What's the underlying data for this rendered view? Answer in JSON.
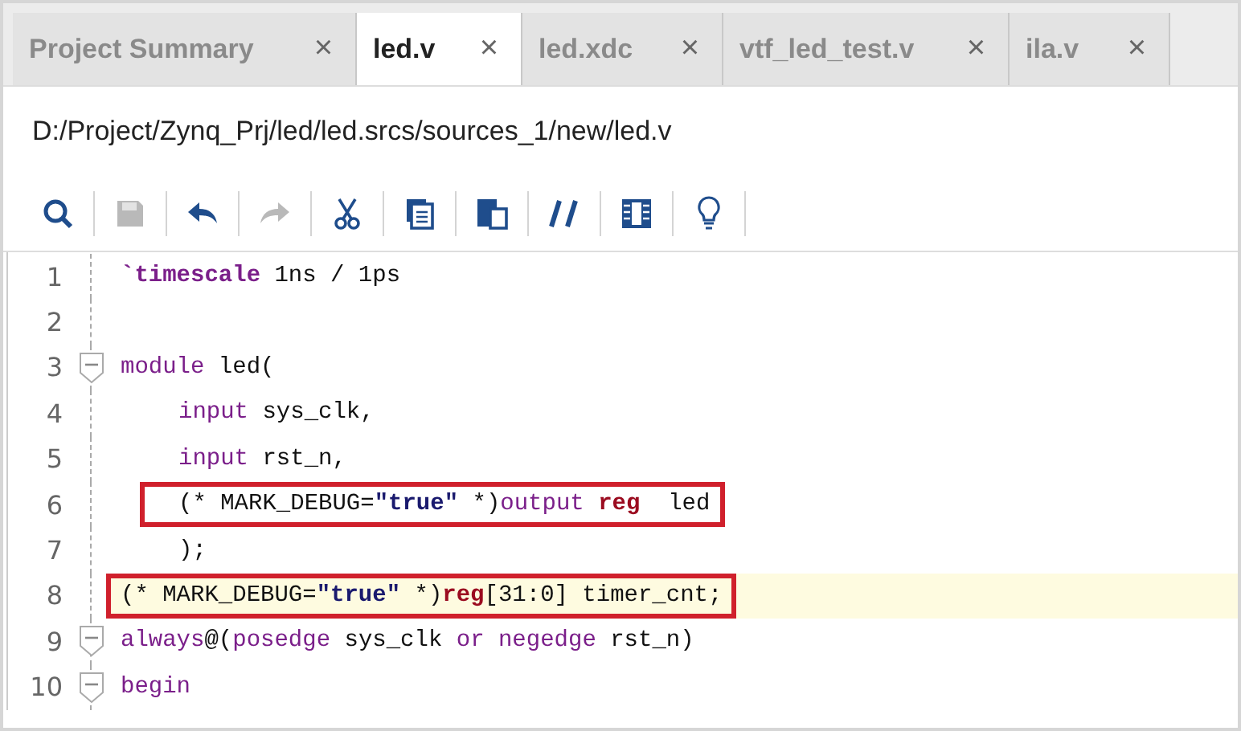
{
  "tabs": [
    {
      "label": "Project Summary",
      "selected": false,
      "close": "×"
    },
    {
      "label": "led.v",
      "selected": true,
      "close": "×"
    },
    {
      "label": "led.xdc",
      "selected": false,
      "close": "×"
    },
    {
      "label": "vtf_led_test.v",
      "selected": false,
      "close": "×"
    },
    {
      "label": "ila.v",
      "selected": false,
      "close": "×"
    }
  ],
  "file_path": "D:/Project/Zynq_Prj/led/led.srcs/sources_1/new/led.v",
  "toolbar": [
    {
      "kind": "search",
      "disabled": false
    },
    {
      "kind": "save",
      "disabled": true
    },
    {
      "kind": "undo",
      "disabled": false
    },
    {
      "kind": "redo",
      "disabled": true
    },
    {
      "kind": "cut",
      "disabled": false
    },
    {
      "kind": "copy",
      "disabled": false
    },
    {
      "kind": "paste",
      "disabled": false
    },
    {
      "kind": "comment",
      "disabled": false
    },
    {
      "kind": "columns",
      "disabled": false
    },
    {
      "kind": "bulb",
      "disabled": false
    }
  ],
  "lines": [
    {
      "number": "1",
      "fold": false,
      "boxed": false,
      "current": false,
      "tokens": [
        {
          "text": "`timescale",
          "kind": "directive"
        },
        {
          "text": " 1ns / 1ps",
          "kind": "plain"
        }
      ]
    },
    {
      "number": "2",
      "fold": false,
      "boxed": false,
      "current": false
    },
    {
      "number": "3",
      "fold": true,
      "boxed": false,
      "current": false,
      "tokens": [
        {
          "text": "module",
          "kind": "keyword"
        },
        {
          "text": " led(",
          "kind": "plain"
        }
      ]
    },
    {
      "number": "4",
      "fold": false,
      "boxed": false,
      "current": false,
      "indented": true,
      "tokens": [
        {
          "text": "input",
          "kind": "keyword"
        },
        {
          "text": " sys_clk,",
          "kind": "plain"
        }
      ]
    },
    {
      "number": "5",
      "fold": false,
      "boxed": false,
      "current": false,
      "indented": true,
      "tokens": [
        {
          "text": "input",
          "kind": "keyword"
        },
        {
          "text": " rst_n,",
          "kind": "plain"
        }
      ]
    },
    {
      "number": "6",
      "fold": false,
      "boxed": true,
      "current": false,
      "indented": true,
      "tokens": [
        {
          "text": "(* MARK_DEBUG=",
          "kind": "plain"
        },
        {
          "text": "\"true\"",
          "kind": "string"
        },
        {
          "text": " *)",
          "kind": "plain"
        },
        {
          "text": "output",
          "kind": "keyword"
        },
        {
          "text": " reg",
          "kind": "type"
        },
        {
          "text": "  led",
          "kind": "plain"
        }
      ]
    },
    {
      "number": "7",
      "fold": false,
      "boxed": false,
      "current": false,
      "indented": true,
      "tokens": [
        {
          "text": ");",
          "kind": "plain"
        }
      ]
    },
    {
      "number": "8",
      "fold": false,
      "boxed": true,
      "current": true,
      "tokens": [
        {
          "text": "(* MARK_DEBUG=",
          "kind": "plain"
        },
        {
          "text": "\"true\"",
          "kind": "string"
        },
        {
          "text": " *)",
          "kind": "plain"
        },
        {
          "text": "reg",
          "kind": "type"
        },
        {
          "text": "[31:0] timer_cnt;",
          "kind": "plain"
        }
      ]
    },
    {
      "number": "9",
      "fold": true,
      "boxed": false,
      "current": false,
      "tokens": [
        {
          "text": "always",
          "kind": "keyword"
        },
        {
          "text": "@(",
          "kind": "plain"
        },
        {
          "text": "posedge",
          "kind": "keyword"
        },
        {
          "text": " sys_clk ",
          "kind": "plain"
        },
        {
          "text": "or",
          "kind": "keyword"
        },
        {
          "text": " negedge",
          "kind": "keyword"
        },
        {
          "text": " rst_n)",
          "kind": "plain"
        }
      ]
    },
    {
      "number": "10",
      "fold": true,
      "boxed": false,
      "current": false,
      "tokens": [
        {
          "text": "begin",
          "kind": "keyword"
        }
      ]
    }
  ]
}
